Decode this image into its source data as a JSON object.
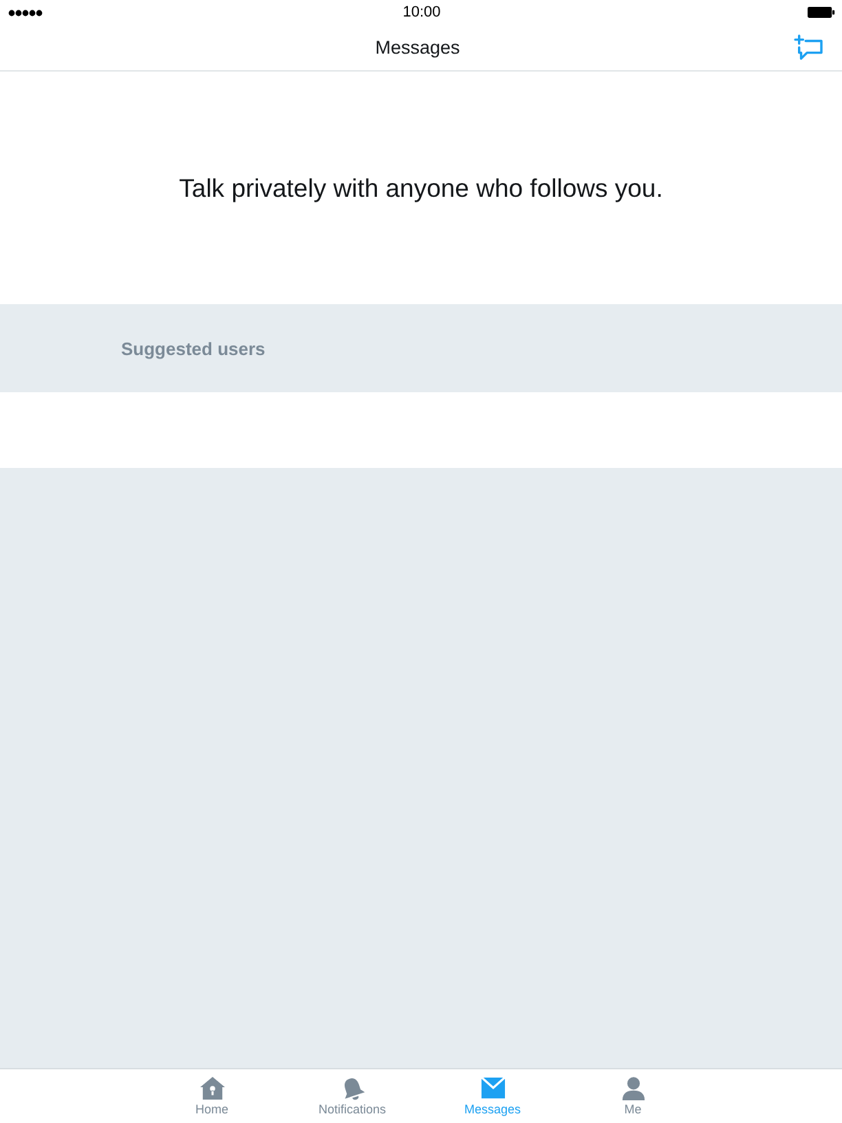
{
  "status_bar": {
    "time": "10:00"
  },
  "nav_bar": {
    "title": "Messages"
  },
  "empty_state": {
    "message": "Talk privately with anyone who follows you."
  },
  "suggested_users": {
    "heading": "Suggested users"
  },
  "tab_bar": {
    "tabs": [
      {
        "label": "Home",
        "kind": "home",
        "selected": false
      },
      {
        "label": "Notifications",
        "kind": "notifications",
        "selected": false
      },
      {
        "label": "Messages",
        "kind": "messages",
        "selected": true
      },
      {
        "label": "Me",
        "kind": "me",
        "selected": false
      }
    ]
  }
}
